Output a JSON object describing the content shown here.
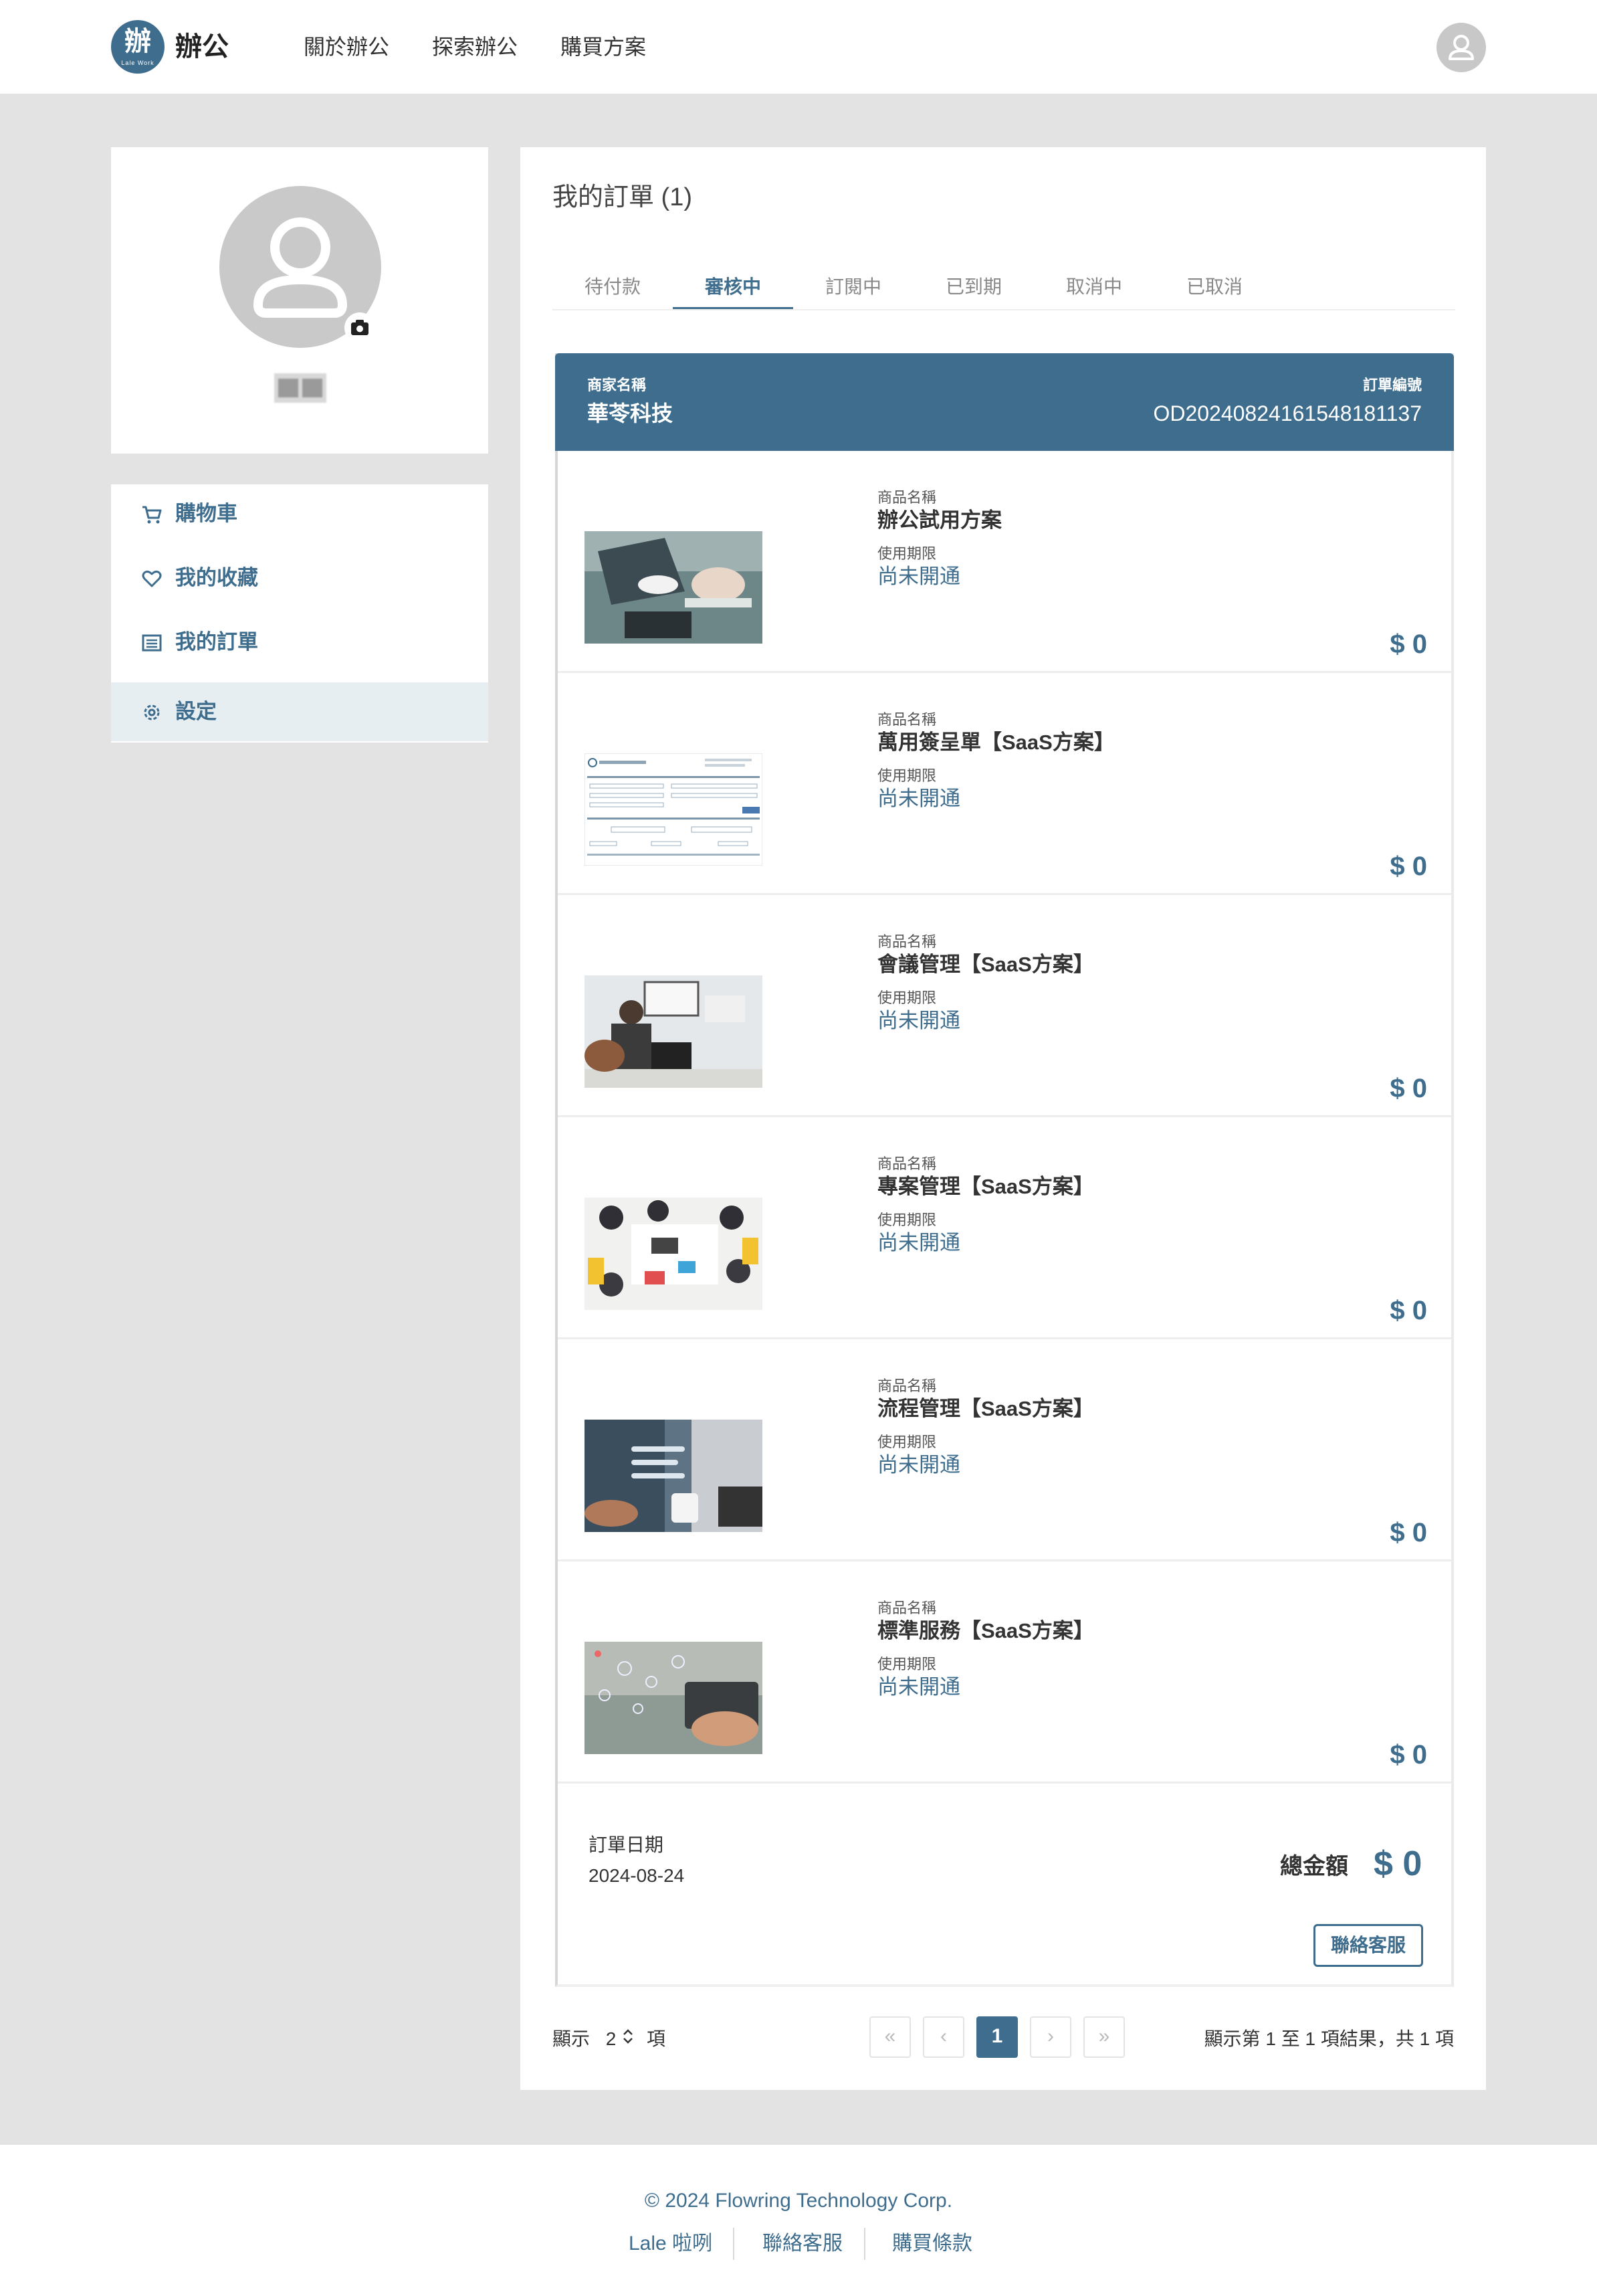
{
  "header": {
    "logo_glyph": "辦",
    "logo_sub": "Lale Work",
    "brand": "辦公",
    "nav": [
      "關於辦公",
      "探索辦公",
      "購買方案"
    ]
  },
  "sidebar": {
    "menu": [
      {
        "label": "購物車",
        "icon": "cart-icon"
      },
      {
        "label": "我的收藏",
        "icon": "heart-icon"
      },
      {
        "label": "我的訂單",
        "icon": "list-icon"
      },
      {
        "label": "設定",
        "icon": "gear-icon"
      }
    ],
    "active_index": 3
  },
  "main": {
    "title": "我的訂單 (1)",
    "tabs": [
      "待付款",
      "審核中",
      "訂閱中",
      "已到期",
      "取消中",
      "已取消"
    ],
    "active_tab": 1
  },
  "order": {
    "merchant_caption": "商家名稱",
    "merchant": "華苓科技",
    "order_no_caption": "訂單編號",
    "order_no": "OD20240824161548181137",
    "items": [
      {
        "name_caption": "商品名稱",
        "name": "辦公試用方案",
        "period_caption": "使用期限",
        "status": "尚未開通",
        "price": "$ 0",
        "image": "laptop-meeting"
      },
      {
        "name_caption": "商品名稱",
        "name": "萬用簽呈單【SaaS方案】",
        "period_caption": "使用期限",
        "status": "尚未開通",
        "price": "$ 0",
        "image": "form-screenshot"
      },
      {
        "name_caption": "商品名稱",
        "name": "會議管理【SaaS方案】",
        "period_caption": "使用期限",
        "status": "尚未開通",
        "price": "$ 0",
        "image": "office-meeting"
      },
      {
        "name_caption": "商品名稱",
        "name": "專案管理【SaaS方案】",
        "period_caption": "使用期限",
        "status": "尚未開通",
        "price": "$ 0",
        "image": "team-table"
      },
      {
        "name_caption": "商品名稱",
        "name": "流程管理【SaaS方案】",
        "period_caption": "使用期限",
        "status": "尚未開通",
        "price": "$ 0",
        "image": "workflow-hand"
      },
      {
        "name_caption": "商品名稱",
        "name": "標準服務【SaaS方案】",
        "period_caption": "使用期限",
        "status": "尚未開通",
        "price": "$ 0",
        "image": "tablet-icons"
      }
    ],
    "date_caption": "訂單日期",
    "date": "2024-08-24",
    "total_label": "總金額",
    "total": "$ 0",
    "contact_button": "聯絡客服"
  },
  "pagination": {
    "show_prefix": "顯示",
    "page_size": "2",
    "show_suffix": "項",
    "first": "«",
    "prev": "‹",
    "current": "1",
    "next": "›",
    "last": "»",
    "result_text": "顯示第 1 至 1 項結果，共 1 項"
  },
  "footer": {
    "copyright": "© 2024 Flowring Technology Corp.",
    "links": [
      "Lale 啦咧",
      "聯絡客服",
      "購買條款"
    ]
  },
  "colors": {
    "primary": "#3e6d8e",
    "page_bg": "#e3e3e3",
    "menu_active_bg": "#e7eef1"
  }
}
